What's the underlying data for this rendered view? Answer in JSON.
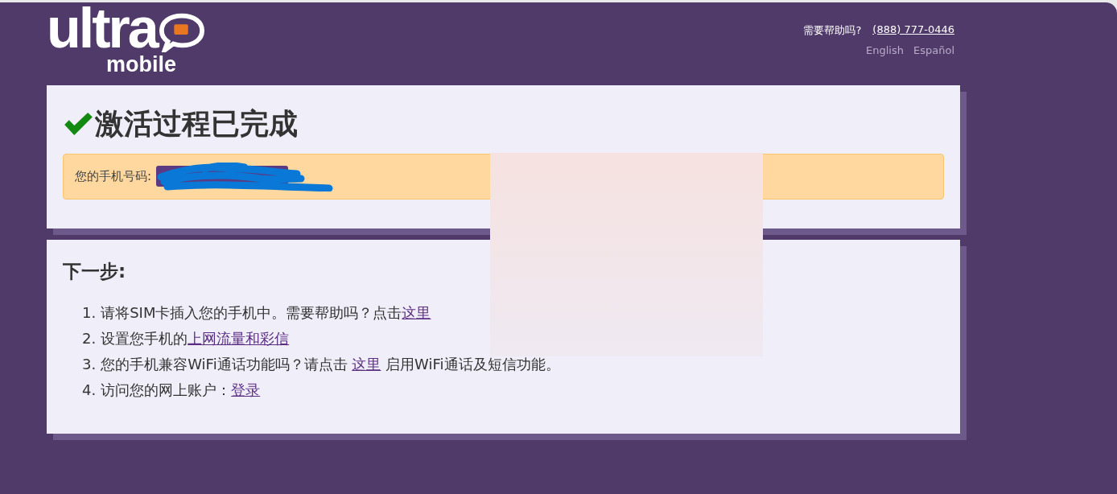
{
  "header": {
    "logo": {
      "word": "ultra",
      "sub": "mobile"
    },
    "help_label": "需要帮助吗?",
    "help_phone": "(888) 777-0446",
    "languages": [
      {
        "label": "English"
      },
      {
        "label": "Español"
      }
    ]
  },
  "status_panel": {
    "title": "激活过程已完成",
    "phone_label": "您的手机号码:",
    "phone_value": {
      "kind": "scribble"
    }
  },
  "next_steps": {
    "title": "下一步:",
    "items": [
      {
        "number": "1.",
        "parts": [
          {
            "text": "请将SIM卡插入您的手机中。需要帮助吗？点击"
          },
          {
            "text": "这里",
            "link": true
          }
        ]
      },
      {
        "number": "2.",
        "parts": [
          {
            "text": "设置您手机的"
          },
          {
            "text": "上网流量和彩信",
            "link": true
          }
        ]
      },
      {
        "number": "3.",
        "parts": [
          {
            "text": "您的手机兼容WiFi通话功能吗？请点击 "
          },
          {
            "text": "这里",
            "link": true
          },
          {
            "text": " 启用WiFi通话及短信功能。"
          }
        ]
      },
      {
        "number": "4.",
        "parts": [
          {
            "text": "访问您的网上账户："
          },
          {
            "text": "登录",
            "link": true
          }
        ]
      }
    ]
  },
  "overlays": [
    {
      "kind": "blur"
    }
  ]
}
